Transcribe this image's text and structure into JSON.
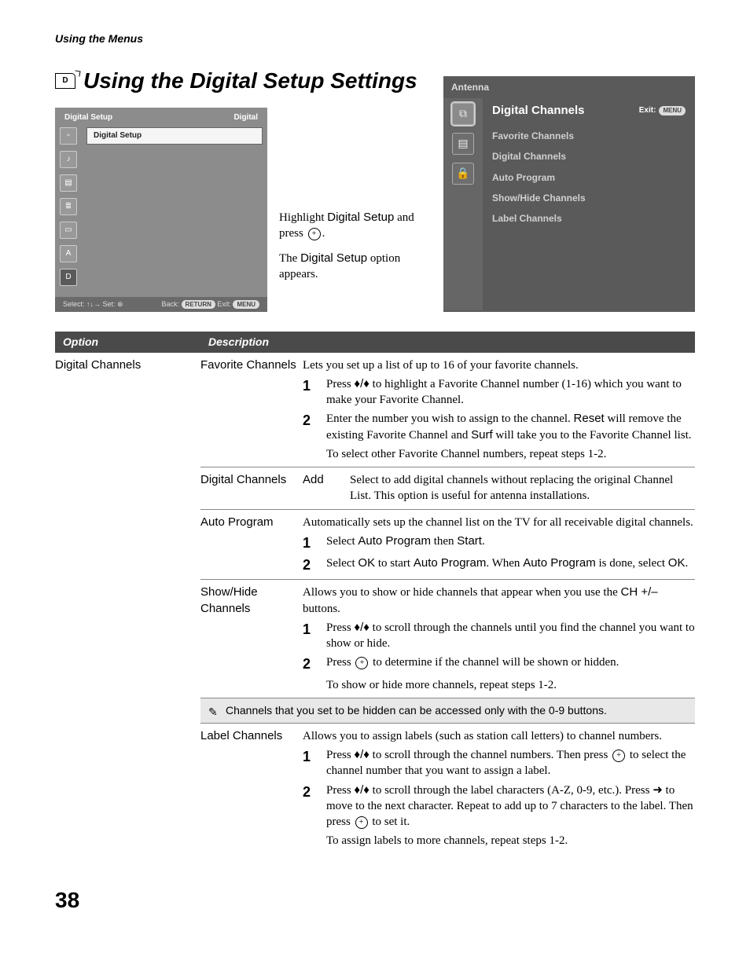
{
  "breadcrumb": "Using the Menus",
  "page_title": "Using the Digital Setup Settings",
  "setup_ss": {
    "header_left": "Digital Setup",
    "header_right": "Digital",
    "selected": "Digital Setup",
    "footer_left": "Select: ↑↓→  Set: ⊕",
    "footer_right_back": "Back:",
    "footer_right_back_pill": "RETURN",
    "footer_right_exit": "Exit:",
    "footer_right_exit_pill": "MENU"
  },
  "middle": {
    "line1a": "Highlight ",
    "line1b": "Digital Setup",
    "line1c": " and press ",
    "line1d": ".",
    "line2a": "The ",
    "line2b": "Digital Setup",
    "line2c": " option appears."
  },
  "antenna_ss": {
    "title": "Antenna",
    "heading": "Digital Channels",
    "exit_label": "Exit:",
    "exit_pill": "MENU",
    "items": [
      "Favorite Channels",
      "Digital Channels",
      "Auto Program",
      "Show/Hide Channels",
      "Label Channels"
    ]
  },
  "table": {
    "header_option": "Option",
    "header_desc": "Description",
    "option": "Digital Channels",
    "favorite": {
      "name": "Favorite Channels",
      "intro": "Lets you set up a list of up to 16 of your favorite channels.",
      "s1a": "Press ",
      "s1b": " to highlight a Favorite Channel number (1-16) which you want to make your Favorite Channel.",
      "s2a": "Enter the number you wish to assign to the channel. ",
      "s2reset": "Reset",
      "s2b": " will remove the existing Favorite Channel and ",
      "s2surf": "Surf",
      "s2c": " will take you to the Favorite Channel list.",
      "s_end": "To select other Favorite Channel numbers, repeat steps 1-2."
    },
    "digital": {
      "name": "Digital Channels",
      "label": "Add",
      "text": "Select to add digital channels without replacing the original Channel List. This option is useful for antenna installations."
    },
    "auto": {
      "name": "Auto Program",
      "intro": "Automatically sets up the channel list on the TV for all receivable digital channels.",
      "s1a": "Select ",
      "s1b": "Auto Program",
      "s1c": " then ",
      "s1d": "Start",
      "s1e": ".",
      "s2a": "Select ",
      "s2b": "OK",
      "s2c": " to start ",
      "s2d": "Auto Program",
      "s2e": ". When ",
      "s2f": "Auto Program",
      "s2g": " is done, select ",
      "s2h": "OK",
      "s2i": "."
    },
    "showhide": {
      "name": "Show/Hide Channels",
      "intro_a": "Allows you to show or hide channels that appear when you use the ",
      "intro_b": "CH +/–",
      "intro_c": " buttons.",
      "s1a": "Press ",
      "s1b": " to scroll through the channels until you find the channel you want to show or hide.",
      "s2a": "Press ",
      "s2b": " to determine if the channel will be shown or hidden.",
      "s_end": "To show or hide more channels, repeat steps 1-2."
    },
    "note": "Channels that you set to be hidden can be accessed only with the 0-9 buttons.",
    "label": {
      "name": "Label Channels",
      "intro": "Allows you to assign labels (such as station call letters) to channel numbers.",
      "s1a": "Press ",
      "s1b": " to scroll through the channel numbers. Then press ",
      "s1c": " to select the channel number that you want to assign a label.",
      "s2a": "Press ",
      "s2b": " to scroll through the label characters (A-Z, 0-9, etc.). Press ",
      "s2c": " to move to the next character. Repeat to add up to 7 characters to the label. Then press ",
      "s2d": " to set it.",
      "s_end": "To assign labels to more channels, repeat steps 1-2."
    }
  },
  "page_num": "38",
  "nums": {
    "n1": "1",
    "n2": "2"
  },
  "arrows": {
    "updown": "♦/♦",
    "right": "➜"
  }
}
